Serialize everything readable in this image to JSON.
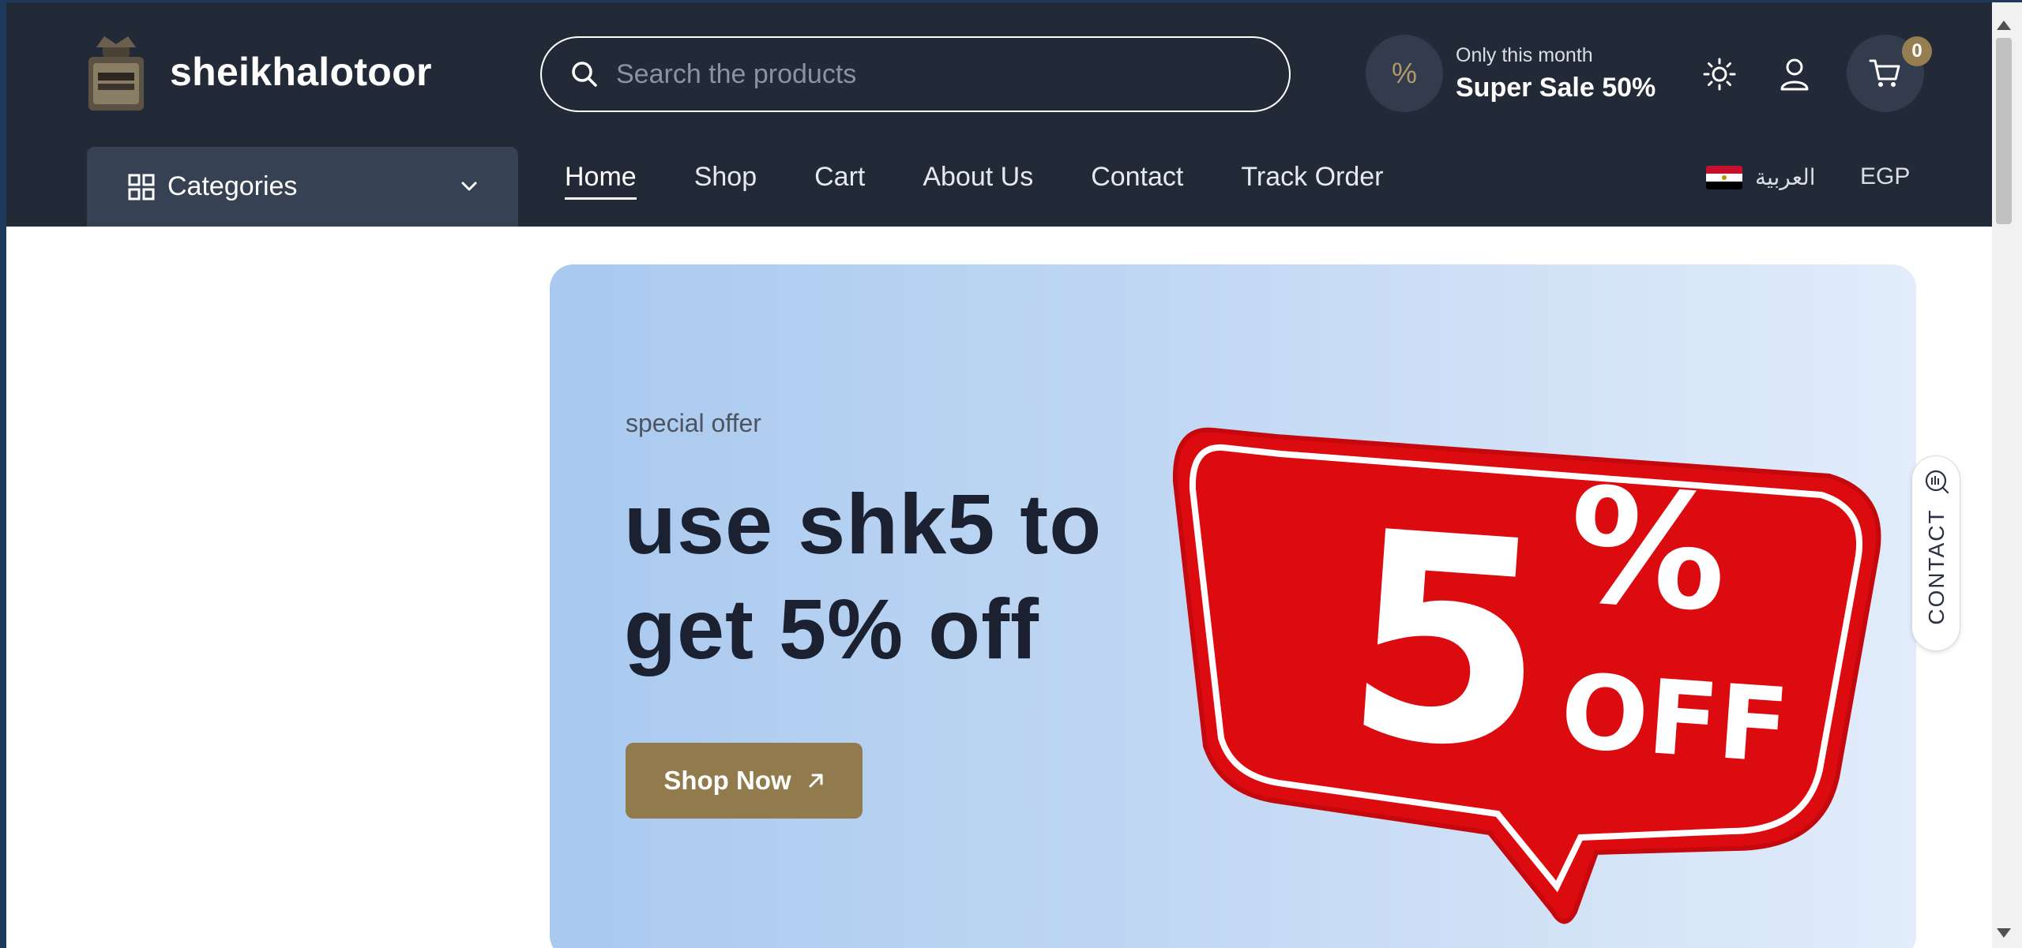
{
  "header": {
    "brand": "sheikhalotoor",
    "search_placeholder": "Search the products",
    "promo": {
      "badge_symbol": "%",
      "small": "Only this month",
      "big": "Super Sale 50%"
    },
    "cart_count": "0",
    "icons": {
      "logo": "perfume-bottle-logo",
      "search": "search-icon",
      "theme": "sun-icon",
      "account": "user-icon",
      "cart": "cart-icon"
    }
  },
  "nav": {
    "categories_label": "Categories",
    "links": [
      "Home",
      "Shop",
      "Cart",
      "About Us",
      "Contact",
      "Track Order"
    ],
    "active": "Home",
    "language": "العربية",
    "currency": "EGP"
  },
  "hero": {
    "eyebrow": "special offer",
    "title": "use shk5 to get 5% off",
    "button_label": "Shop Now",
    "art_number": "5",
    "art_percent": "%",
    "art_word": "OFF"
  },
  "contact_tab": {
    "label": "CONTACT"
  },
  "colors": {
    "header_bg": "#222a38",
    "categories_bg": "#364254",
    "accent_gold": "#917b4c",
    "sale_red": "#dc0b10",
    "hero_gradient_start": "#a9c9ef",
    "hero_gradient_end": "#e2ecfa"
  }
}
